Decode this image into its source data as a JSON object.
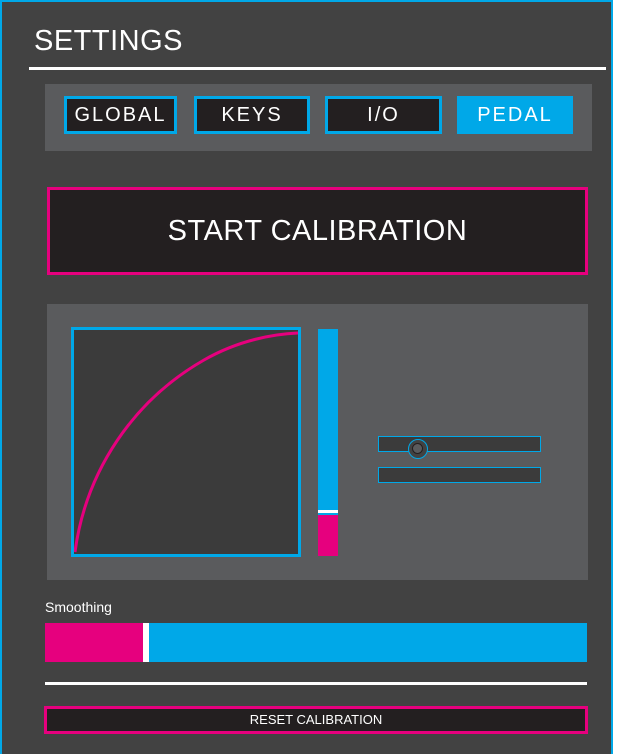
{
  "header": {
    "title": "SETTINGS"
  },
  "tabs": [
    {
      "label": "GLOBAL",
      "active": false
    },
    {
      "label": "KEYS",
      "active": false
    },
    {
      "label": "I/O",
      "active": false
    },
    {
      "label": "PEDAL",
      "active": true
    }
  ],
  "calibration": {
    "start_label": "START CALIBRATION",
    "reset_label": "RESET CALIBRATION"
  },
  "pedal_level": {
    "fraction": 0.18,
    "marker_fraction": 0.19
  },
  "sliders": {
    "a_position": 0.24,
    "b_position": null
  },
  "smoothing": {
    "label": "Smoothing",
    "value": 0.18
  },
  "colors": {
    "accent_blue": "#00a8e8",
    "accent_magenta": "#e6007e",
    "panel": "#424242",
    "dark": "#231f20",
    "surface": "#5a5b5d"
  },
  "icons": {
    "response_curve": "curve-graph",
    "slider_handle": "circle-knob"
  }
}
